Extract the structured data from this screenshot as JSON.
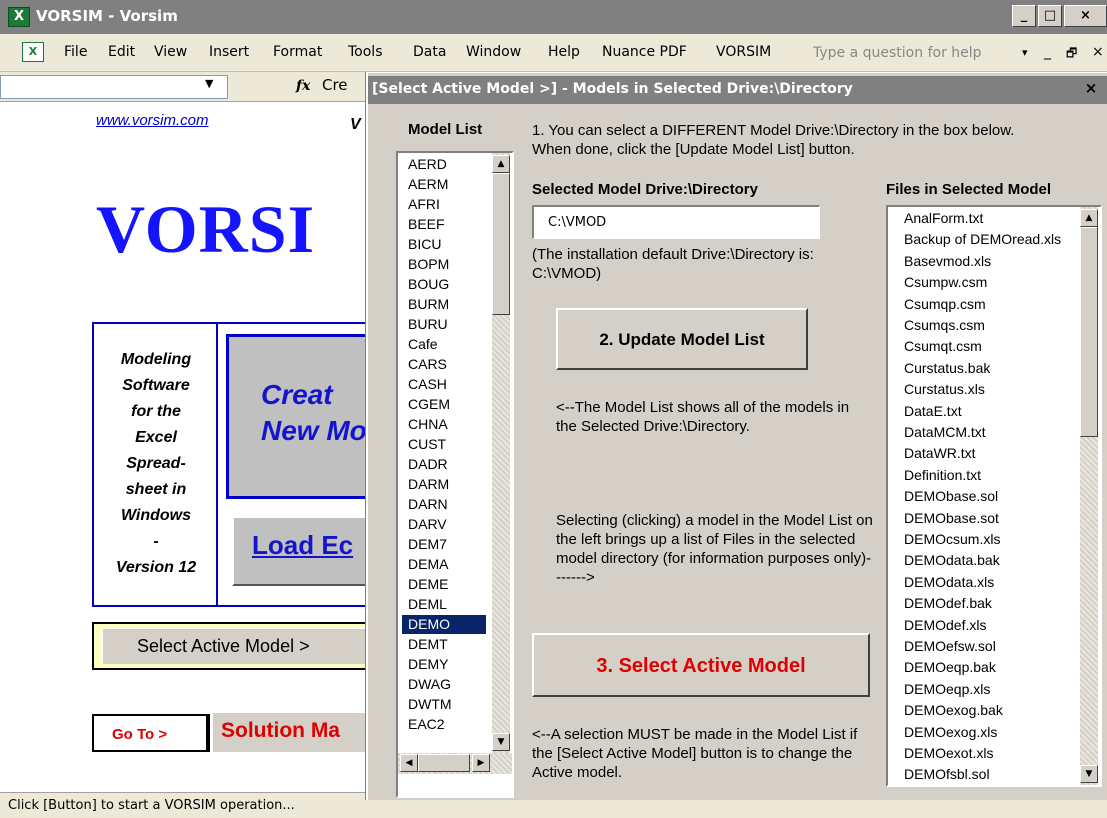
{
  "window": {
    "title": "VORSIM - Vorsim",
    "app_icon": "excel-icon",
    "controls": {
      "minimize": "_",
      "maximize": "□",
      "close": "×"
    }
  },
  "menubar": {
    "items": [
      "File",
      "Edit",
      "View",
      "Insert",
      "Format",
      "Tools",
      "Data",
      "Window",
      "Help",
      "Nuance PDF",
      "VORSIM"
    ],
    "help_placeholder": "Type a question for help",
    "doc_controls": [
      "▾",
      "_",
      "🗗",
      "×"
    ]
  },
  "formula_bar": {
    "name_box": "",
    "fx": "fx",
    "content": "Cre"
  },
  "sheet": {
    "link": "www.vorsim.com",
    "link_fragment": "V",
    "big_title": "VORSI",
    "side_text": [
      "Modeling",
      "Software",
      "for the",
      "Excel",
      "Spread-",
      "sheet in",
      "Windows",
      "-",
      "Version 12"
    ],
    "create_button": [
      "Creat",
      "New Mo"
    ],
    "load_button": "Load Ec",
    "select_active_button": "Select Active Model >",
    "goto_label": "Go To >",
    "solution_button": "Solution Ma"
  },
  "status_bar": "Click [Button] to start a VORSIM operation...",
  "dialog": {
    "title": "[Select Active Model >] - Models in Selected Drive:\\Directory",
    "close": "×",
    "model_list_header": "Model List",
    "model_list": [
      "AERD",
      "AERM",
      "AFRI",
      "BEEF",
      "BICU",
      "BOPM",
      "BOUG",
      "BURM",
      "BURU",
      "Cafe",
      "CARS",
      "CASH",
      "CGEM",
      "CHNA",
      "CUST",
      "DADR",
      "DARM",
      "DARN",
      "DARV",
      "DEM7",
      "DEMA",
      "DEME",
      "DEML",
      "DEMO",
      "DEMT",
      "DEMY",
      "DWAG",
      "DWTM",
      "EAC2"
    ],
    "selected_model": "DEMO",
    "instructions_1": "1. You can select a DIFFERENT Model Drive:\\Directory in the box below.  When done, click the [Update Model List] button.",
    "dir_header": "Selected Model Drive:\\Directory",
    "dir_value": "C:\\VMOD",
    "dir_note": "(The installation default Drive:\\Directory is:  C:\\VMOD)",
    "update_button": "2. Update Model List",
    "model_list_note": "<--The Model List shows all of the models in the Selected Drive:\\Directory.",
    "selecting_note": "Selecting (clicking) a model in the Model List on the left brings up a list of Files in the selected model directory (for information purposes only)------->",
    "select_button": "3. Select Active Model",
    "select_note": "<--A selection MUST be made in the Model List if the [Select Active Model] button is to change the Active model.",
    "files_header": "Files in Selected Model",
    "files": [
      "AnalForm.txt",
      "Backup of DEMOread.xls",
      "Basevmod.xls",
      "Csumpw.csm",
      "Csumqp.csm",
      "Csumqs.csm",
      "Csumqt.csm",
      "Curstatus.bak",
      "Curstatus.xls",
      "DataE.txt",
      "DataMCM.txt",
      "DataWR.txt",
      "Definition.txt",
      "DEMObase.sol",
      "DEMObase.sot",
      "DEMOcsum.xls",
      "DEMOdata.bak",
      "DEMOdata.xls",
      "DEMOdef.bak",
      "DEMOdef.xls",
      "DEMOefsw.sol",
      "DEMOeqp.bak",
      "DEMOeqp.xls",
      "DEMOexog.bak",
      "DEMOexog.xls",
      "DEMOexot.xls",
      "DEMOfsbl.sol"
    ]
  },
  "colors": {
    "title_blue": "#1414ff",
    "red_button": "#e00000",
    "selection": "#0a246a",
    "dialog_face": "#d4d0c8"
  }
}
